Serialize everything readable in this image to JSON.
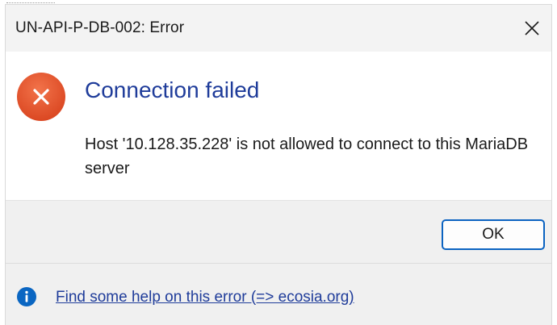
{
  "dialog": {
    "title": "UN-API-P-DB-002: Error",
    "heading": "Connection failed",
    "message": "Host '10.128.35.228' is not allowed to connect to this MariaDB server",
    "ok_label": "OK",
    "help_link_text": "Find some help on this error (=> ecosia.org)"
  },
  "icons": {
    "close": "close-icon",
    "error": "error-icon",
    "info": "info-icon"
  },
  "colors": {
    "accent_blue": "#1f3c9a",
    "focus_border": "#0b63c1",
    "error_red": "#e1502a",
    "info_blue": "#0a66c2",
    "panel_gray": "#f0f0f0"
  }
}
